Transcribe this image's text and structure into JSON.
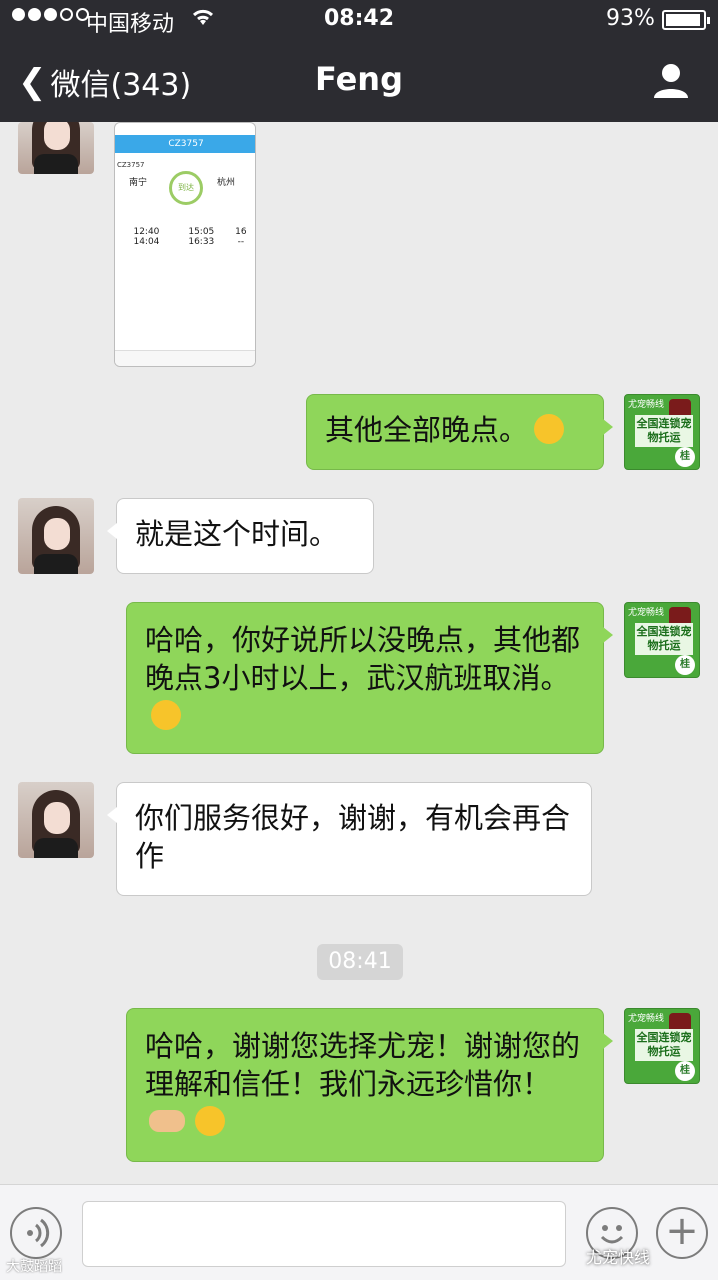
{
  "status_bar": {
    "carrier": "中国移动",
    "time": "08:42",
    "battery": "93%",
    "signal_bars_filled": 3,
    "signal_bars_total": 5
  },
  "nav": {
    "back_label": "微信(343)",
    "title": "Feng"
  },
  "shared_image": {
    "header": "CZ3757",
    "flight_no": "CZ3757",
    "from_city": "南宁",
    "to_city": "杭州",
    "status": "到达",
    "rows": [
      [
        "12:40",
        "15:05",
        "16"
      ],
      [
        "14:04",
        "16:33",
        "--"
      ]
    ]
  },
  "messages": [
    {
      "from": "me",
      "text": "其他全部晚点。",
      "emoji": "grin-sweat"
    },
    {
      "from": "them",
      "text": "就是这个时间。"
    },
    {
      "from": "me",
      "text": "哈哈，你好说所以没晚点，其他都晚点3小时以上，武汉航班取消。",
      "emoji": "shocked"
    },
    {
      "from": "them",
      "text": "你们服务很好，谢谢，有机会再合作"
    },
    {
      "from": "me",
      "text": "哈哈，谢谢您选择尤宠！谢谢您的理解和信任！我们永远珍惜你！",
      "emoji": "handshake-hug"
    }
  ],
  "time_divider": "08:41",
  "business_avatar": {
    "top_text": "尤宠畅线",
    "main_text": "全国连锁宠物托运",
    "badge": "桂"
  },
  "watermarks": {
    "left": "大鼓蹈蹈",
    "right": "尤宠快线"
  },
  "colors": {
    "nav_bg": "#2c2c31",
    "my_bubble": "#8fd65a",
    "their_bubble": "#ffffff",
    "chat_bg": "#ebebeb"
  }
}
